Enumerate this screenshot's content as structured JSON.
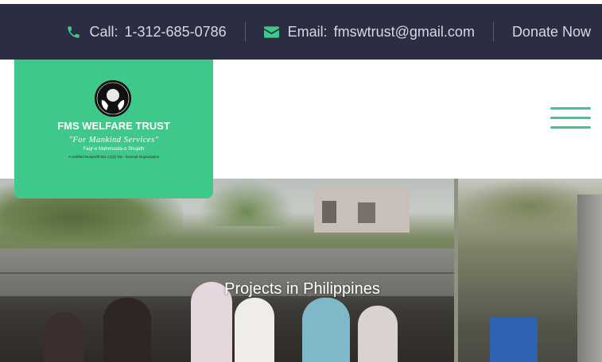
{
  "topbar": {
    "call_label": "Call:",
    "call_value": "1-312-685-0786",
    "email_label": "Email:",
    "email_value": "fmswtrust@gmail.com",
    "donate_label": "Donate Now"
  },
  "logo": {
    "name": "FMS WELFARE TRUST",
    "tagline": "\"For Mankind Services\"",
    "subline": "Faqr-e Mahmooda-o Shujath",
    "certification": "A certified Nonprofit 501 (c)(3) Tax - Exempt Organization"
  },
  "hero": {
    "title": "Projects in Philippines"
  },
  "colors": {
    "topbar_bg": "#2b2d42",
    "accent": "#3ec98a",
    "topbar_text": "#d8d8e0"
  },
  "icons": {
    "phone": "phone-icon",
    "email": "envelope-icon",
    "menu": "hamburger-menu-icon",
    "emblem": "hands-globe-emblem-icon"
  }
}
